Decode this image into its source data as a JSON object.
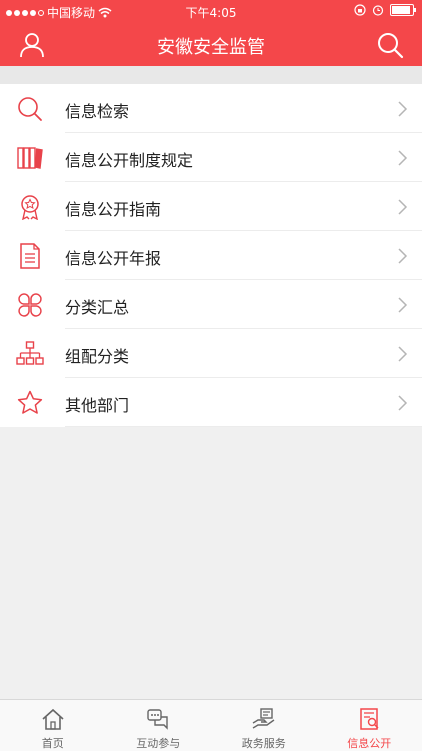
{
  "status_bar": {
    "carrier": "中国移动",
    "time": "下午4:05"
  },
  "header": {
    "title": "安徽安全监管"
  },
  "menu": [
    {
      "label": "信息检索",
      "icon": "search-icon"
    },
    {
      "label": "信息公开制度规定",
      "icon": "books-icon"
    },
    {
      "label": "信息公开指南",
      "icon": "award-icon"
    },
    {
      "label": "信息公开年报",
      "icon": "document-icon"
    },
    {
      "label": "分类汇总",
      "icon": "clover-icon"
    },
    {
      "label": "组配分类",
      "icon": "hierarchy-icon"
    },
    {
      "label": "其他部门",
      "icon": "star-icon"
    }
  ],
  "tabs": [
    {
      "label": "首页",
      "icon": "home-icon",
      "active": false
    },
    {
      "label": "互动参与",
      "icon": "chat-icon",
      "active": false
    },
    {
      "label": "政务服务",
      "icon": "service-icon",
      "active": false
    },
    {
      "label": "信息公开",
      "icon": "info-public-icon",
      "active": true
    }
  ],
  "colors": {
    "accent": "#f4474a",
    "background": "#f0f0f0"
  }
}
